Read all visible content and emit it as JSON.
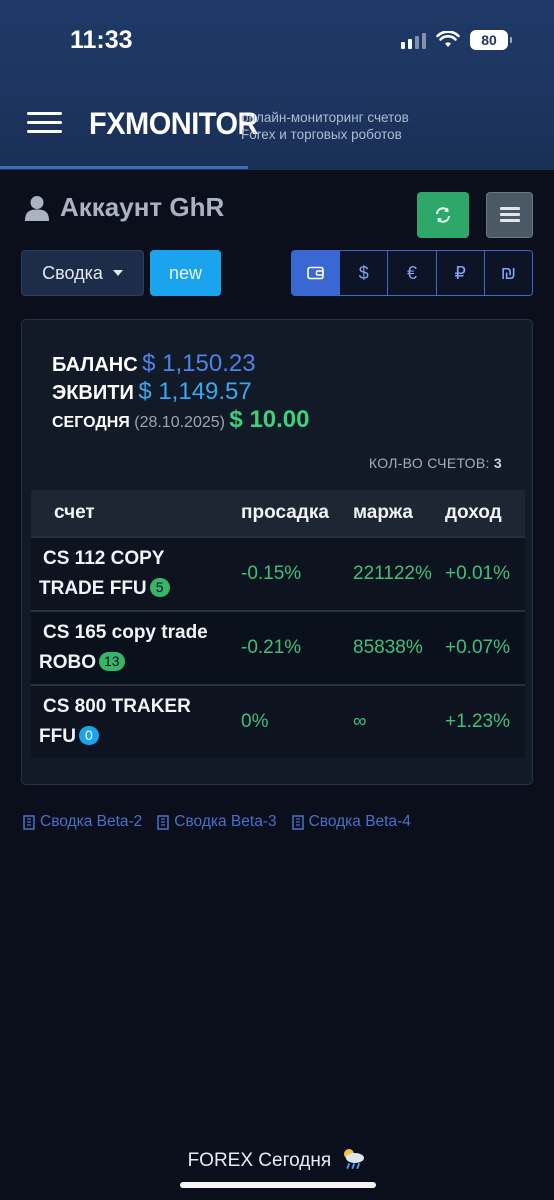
{
  "status_bar": {
    "time": "11:33",
    "battery": "80"
  },
  "header": {
    "logo": "FXMONITOR",
    "tagline_line1": "онлайн-мониторинг счетов",
    "tagline_line2": "Forex и торговых роботов"
  },
  "account": {
    "title": "Аккаунт GhR"
  },
  "controls": {
    "summary_label": "Сводка",
    "new_label": "new",
    "currencies": [
      "wallet-icon",
      "$",
      "€",
      "₽",
      "₪"
    ]
  },
  "summary": {
    "balance_label": "БАЛАНС",
    "balance_value": "$ 1,150.23",
    "equity_label": "ЭКВИТИ",
    "equity_value": "$ 1,149.57",
    "today_label": "СЕГОДНЯ",
    "today_date": "(28.10.2025)",
    "today_value": "$ 10.00",
    "count_label": "КОЛ-ВО СЧЕТОВ:",
    "count_value": "3"
  },
  "table": {
    "headers": [
      "счет",
      "просадка",
      "маржа",
      "доход"
    ],
    "rows": [
      {
        "name_l1": "CS 112 COPY",
        "name_l2": "TRADE FFU",
        "badge": "5",
        "drawdown": "-0.15%",
        "margin": "221122%",
        "income": "+0.01%"
      },
      {
        "name_l1": "CS 165 copy trade",
        "name_l2": "ROBO",
        "badge": "13",
        "drawdown": "-0.21%",
        "margin": "85838%",
        "income": "+0.07%"
      },
      {
        "name_l1": "CS 800 TRAKER",
        "name_l2": "FFU",
        "badge": "0",
        "drawdown": "0%",
        "margin": "∞",
        "income": "+1.23%"
      }
    ]
  },
  "beta_links": [
    "Сводка Beta-2",
    "Сводка Beta-3",
    "Сводка Beta-4"
  ],
  "footer": {
    "text": "FOREX Сегодня"
  },
  "colors": {
    "accent": "#3a68d2",
    "green": "#3fc07a",
    "header": "#1d3560"
  }
}
